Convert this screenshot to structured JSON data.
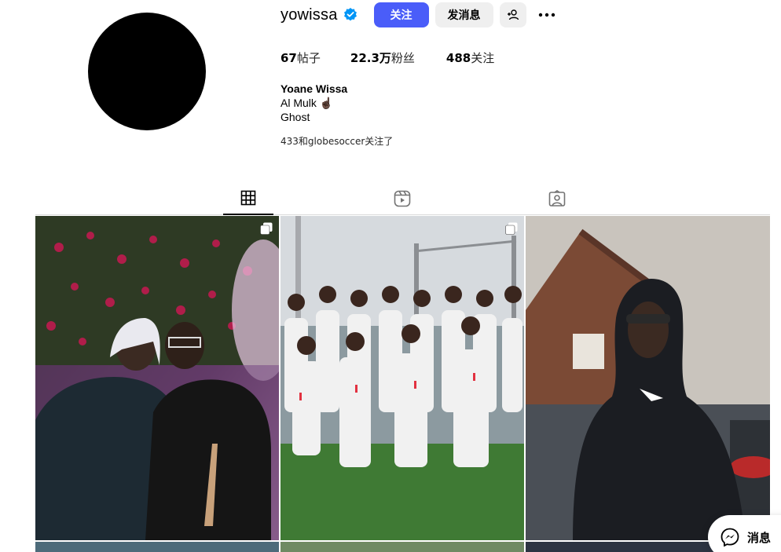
{
  "profile": {
    "username": "yowissa",
    "follow_label": "关注",
    "message_label": "发消息",
    "full_name": "Yoane Wissa",
    "bio_line1": "Al Mulk ☝🏿",
    "bio_line2": "Ghost",
    "followed_by": "433和globesoccer关注了"
  },
  "stats": {
    "posts_count": "67",
    "posts_label": "帖子",
    "followers_count": "22.3万",
    "followers_label": "粉丝",
    "following_count": "488",
    "following_label": "关注"
  },
  "tabs": [
    "posts",
    "reels",
    "tagged"
  ],
  "float": {
    "messages_label": "消息"
  },
  "colors": {
    "accent": "#4a5df9",
    "verified": "#0095f6",
    "button_bg": "#efefef"
  },
  "icons": [
    "verified-badge-icon",
    "add-person-icon",
    "more-dots-icon",
    "grid-icon",
    "reels-icon",
    "tagged-icon",
    "carousel-icon",
    "messenger-icon"
  ]
}
